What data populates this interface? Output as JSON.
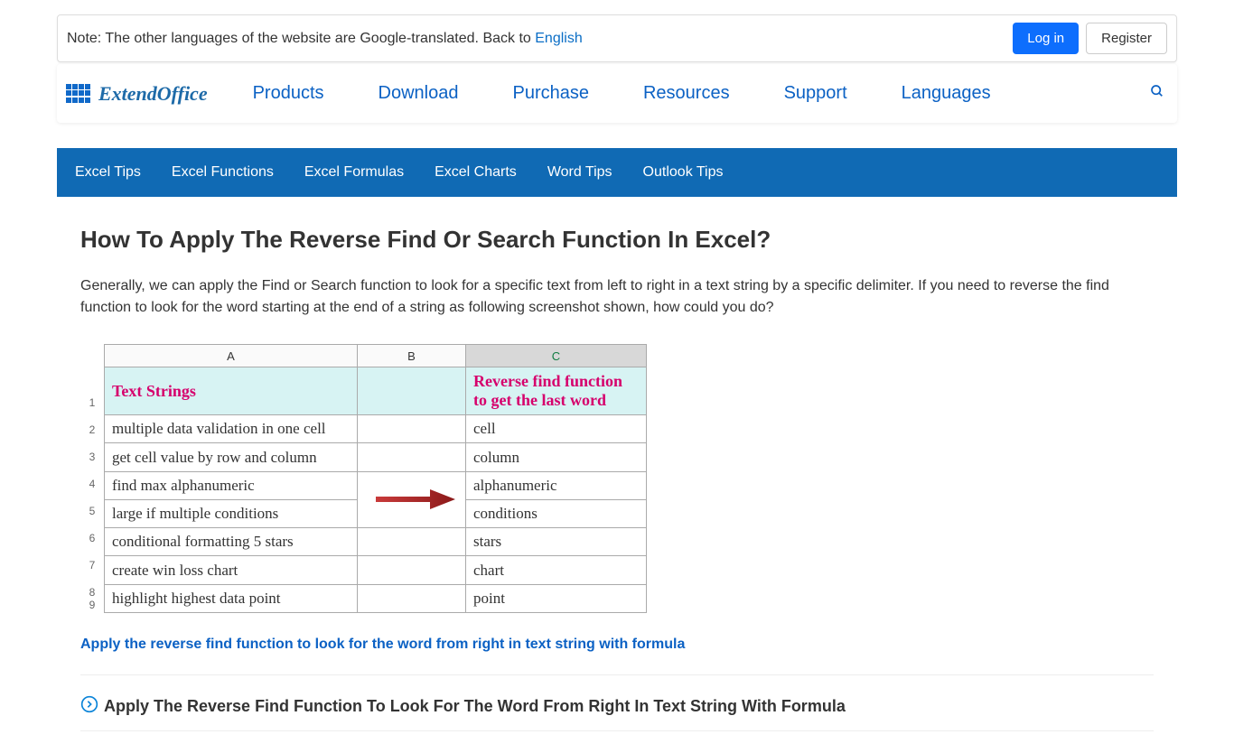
{
  "topbar": {
    "note_prefix": "Note: The other languages of the website are Google-translated. Back to ",
    "english_link": "English",
    "login_label": "Log in",
    "register_label": "Register"
  },
  "logo": {
    "extend": "Extend",
    "office": "Office"
  },
  "menu": {
    "products": "Products",
    "download": "Download",
    "purchase": "Purchase",
    "resources": "Resources",
    "support": "Support",
    "languages": "Languages"
  },
  "subnav": {
    "excel_tips": "Excel Tips",
    "excel_functions": "Excel Functions",
    "excel_formulas": "Excel Formulas",
    "excel_charts": "Excel Charts",
    "word_tips": "Word Tips",
    "outlook_tips": "Outlook Tips"
  },
  "page_title": "How To Apply The Reverse Find Or Search Function In Excel?",
  "intro": "Generally, we can apply the Find or Search function to look for a specific text from left to right in a text string by a specific delimiter. If you need to reverse the find function to look for the word starting at the end of a string as following screenshot shown, how could you do?",
  "excel": {
    "cols": {
      "a": "A",
      "b": "B",
      "c": "C"
    },
    "header_a": "Text Strings",
    "header_c1": "Reverse find function",
    "header_c2": "to get the last word",
    "rows": [
      {
        "n": "2",
        "a": "multiple data validation in one cell",
        "c": "cell"
      },
      {
        "n": "3",
        "a": " get cell value by row and column",
        "c": "column"
      },
      {
        "n": "4",
        "a": "find max alphanumeric",
        "c": "alphanumeric"
      },
      {
        "n": "5",
        "a": "large if multiple conditions",
        "c": "conditions"
      },
      {
        "n": "6",
        "a": "conditional formatting 5 stars",
        "c": "stars"
      },
      {
        "n": "7",
        "a": "create win loss chart",
        "c": "chart"
      },
      {
        "n": "8",
        "a": "highlight highest data point",
        "c": "point"
      }
    ],
    "row1": "1",
    "row9": "9"
  },
  "anchor_link": "Apply the reverse find function to look for the word from right in text string with formula",
  "section_title": "Apply The Reverse Find Function To Look For The Word From Right In Text String With Formula"
}
